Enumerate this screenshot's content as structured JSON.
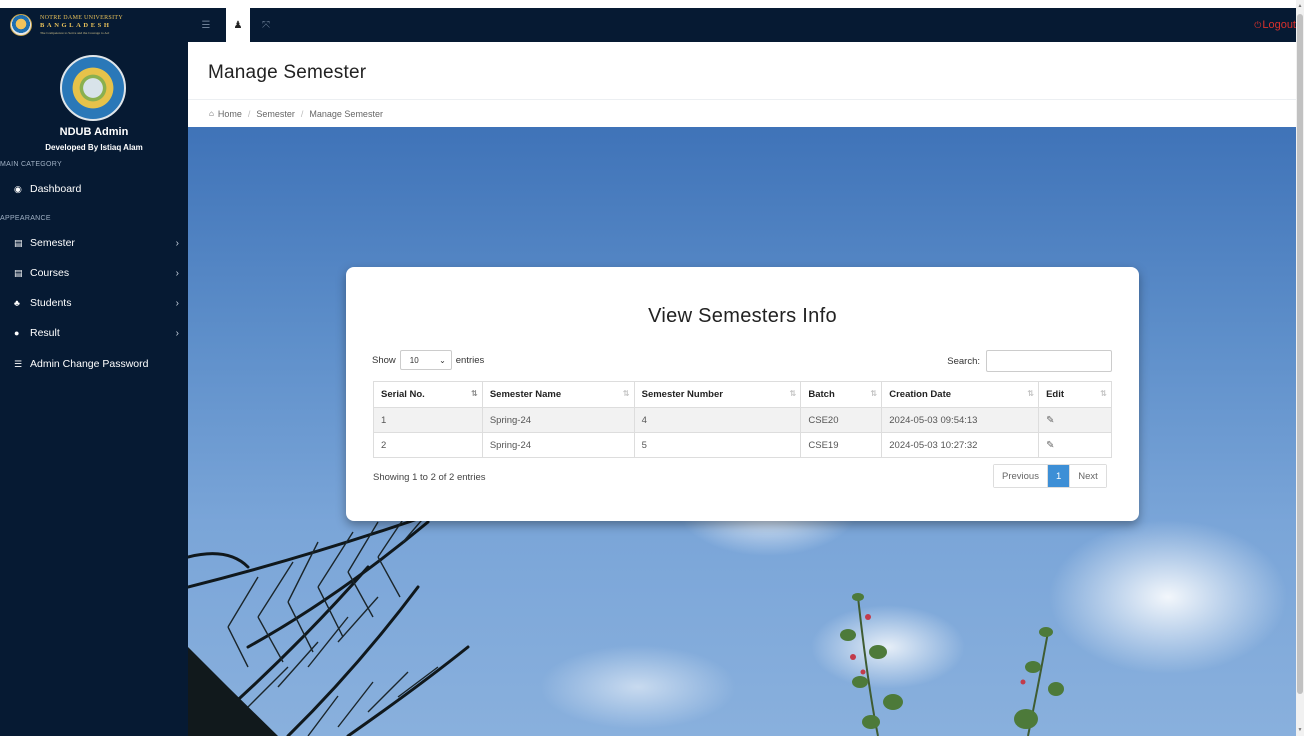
{
  "brand": {
    "line1": "NOTRE DAME UNIVERSITY",
    "line2": "BANGLADESH",
    "line3": "The Competence to Serve and the Courage to Act"
  },
  "topbar": {
    "logout_label": "Logout",
    "icons": [
      "list-icon",
      "user-icon",
      "expand-icon",
      "power-icon"
    ]
  },
  "sidebar": {
    "admin_name": "NDUB Admin",
    "developer": "Developed By Istiaq Alam",
    "main_heading": "MAIN CATEGORY",
    "appearance_heading": "APPEARANCE",
    "items": [
      {
        "label": "Dashboard",
        "icon": "dashboard-icon"
      },
      {
        "label": "Semester",
        "icon": "file-icon"
      },
      {
        "label": "Courses",
        "icon": "file-icon"
      },
      {
        "label": "Students",
        "icon": "users-icon"
      },
      {
        "label": "Result",
        "icon": "info-icon"
      },
      {
        "label": "Admin Change Password",
        "icon": "list-icon"
      }
    ]
  },
  "page": {
    "title": "Manage Semester",
    "breadcrumb": [
      "Home",
      "Semester",
      "Manage Semester"
    ]
  },
  "card": {
    "title": "View Semesters Info",
    "length": {
      "show_label": "Show",
      "value": "10",
      "entries_label": "entries"
    },
    "search_label": "Search:",
    "search_value": "",
    "columns": [
      "Serial No.",
      "Semester Name",
      "Semester Number",
      "Batch",
      "Creation Date",
      "Edit"
    ],
    "rows": [
      {
        "serial": "1",
        "name": "Spring-24",
        "number": "4",
        "batch": "CSE20",
        "date": "2024-05-03 09:54:13"
      },
      {
        "serial": "2",
        "name": "Spring-24",
        "number": "5",
        "batch": "CSE19",
        "date": "2024-05-03 10:27:32"
      }
    ],
    "info": "Showing 1 to 2 of 2 entries",
    "pager": {
      "previous": "Previous",
      "current": "1",
      "next": "Next"
    }
  },
  "colors": {
    "navbar": "#061a33",
    "pager_active": "#3d8fd6",
    "logout": "#d9302c"
  }
}
